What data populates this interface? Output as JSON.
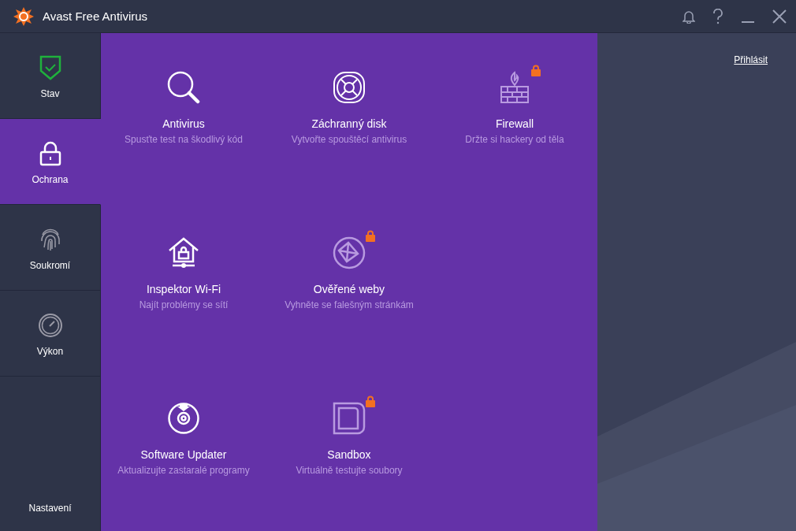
{
  "window": {
    "title": "Avast Free Antivirus"
  },
  "sidebar": {
    "items": [
      {
        "label": "Stav",
        "selected": false
      },
      {
        "label": "Ochrana",
        "selected": true
      },
      {
        "label": "Soukromí",
        "selected": false
      },
      {
        "label": "Výkon",
        "selected": false
      }
    ],
    "settings": "Nastavení"
  },
  "features": [
    {
      "title": "Antivirus",
      "subtitle": "Spusťte test na škodlivý kód",
      "locked": false
    },
    {
      "title": "Záchranný disk",
      "subtitle": "Vytvořte spouštěcí antivirus",
      "locked": false
    },
    {
      "title": "Firewall",
      "subtitle": "Držte si hackery od těla",
      "locked": true
    },
    {
      "title": "Inspektor Wi-Fi",
      "subtitle": "Najít problémy se sítí",
      "locked": false
    },
    {
      "title": "Ověřené weby",
      "subtitle": "Vyhněte se falešným stránkám",
      "locked": true
    },
    {
      "title": "Software Updater",
      "subtitle": "Aktualizujte zastaralé programy",
      "locked": false
    },
    {
      "title": "Sandbox",
      "subtitle": "Virtuálně testujte soubory",
      "locked": true
    }
  ],
  "account": {
    "login": "Přihlásit"
  }
}
